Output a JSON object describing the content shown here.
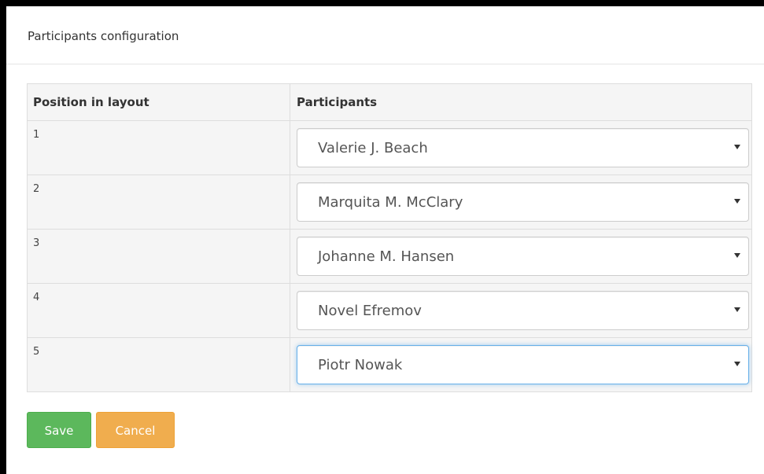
{
  "modal": {
    "title": "Participants configuration"
  },
  "table": {
    "headers": {
      "position": "Position in layout",
      "participants": "Participants"
    },
    "rows": [
      {
        "position": "1",
        "participant": "Valerie J. Beach"
      },
      {
        "position": "2",
        "participant": "Marquita M. McClary"
      },
      {
        "position": "3",
        "participant": "Johanne M. Hansen"
      },
      {
        "position": "4",
        "participant": "Novel Efremov"
      },
      {
        "position": "5",
        "participant": "Piotr Nowak"
      }
    ]
  },
  "icons": {
    "dropdown": "chevron-down-icon"
  },
  "buttons": {
    "save_label": "Save",
    "cancel_label": "Cancel"
  },
  "colors": {
    "save": "#5cb85c",
    "cancel": "#f0ad4e",
    "focus": "#66afe9"
  }
}
